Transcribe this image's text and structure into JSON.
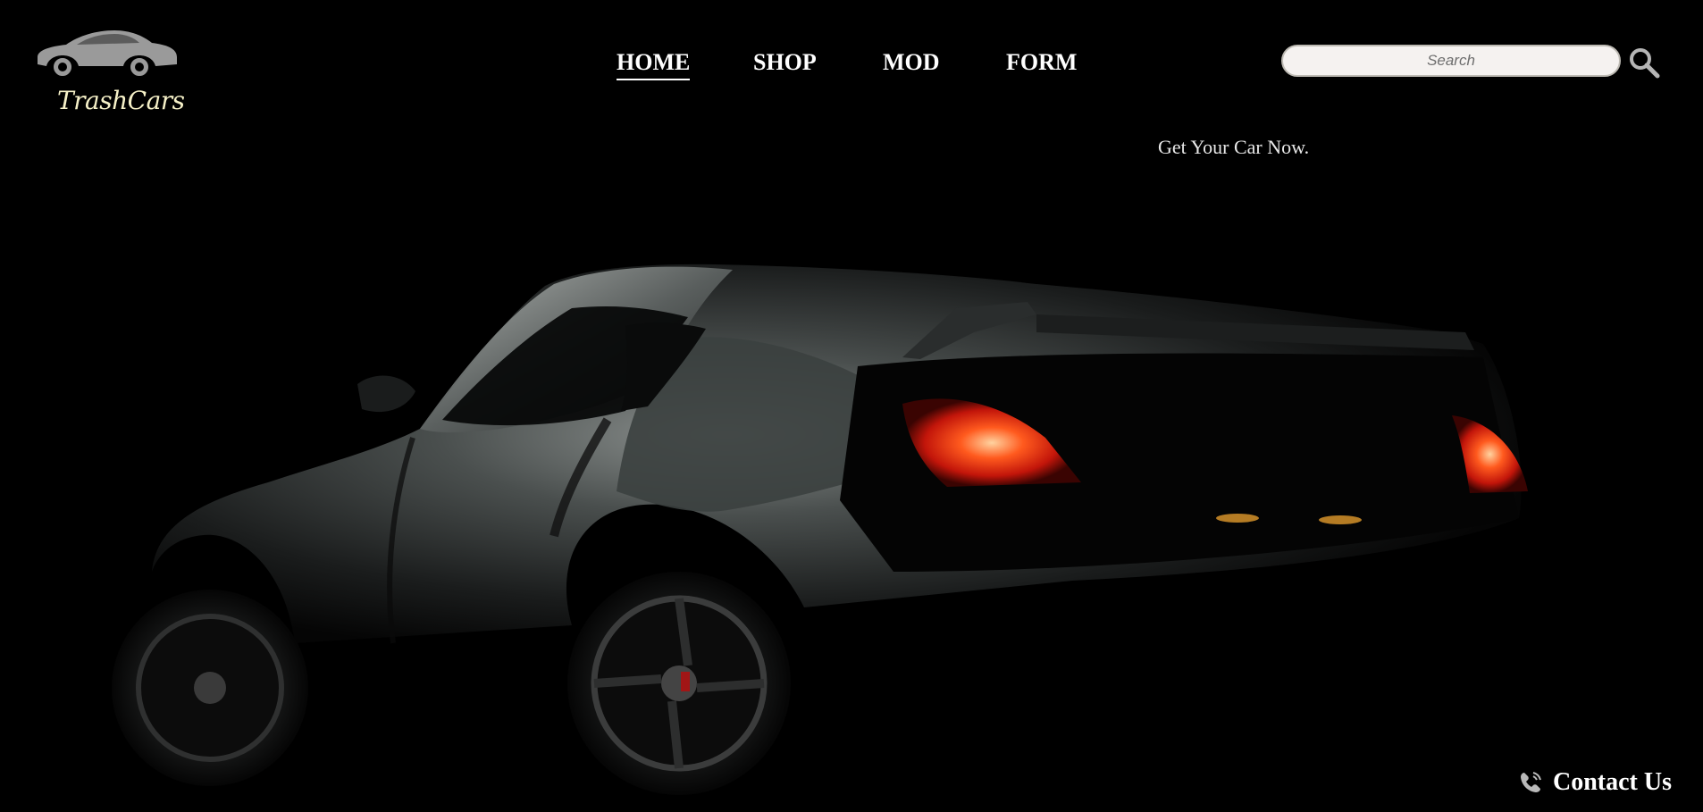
{
  "brand": {
    "name": "TrashCars",
    "logo_icon": "car-silhouette-icon",
    "logo_color": "#9a9a9a",
    "name_color": "#f6f1c8"
  },
  "nav": {
    "items": [
      {
        "label": "HOME",
        "active": true
      },
      {
        "label": "SHOP",
        "active": false
      },
      {
        "label": "MOD",
        "active": false
      },
      {
        "label": "FORM",
        "active": false
      }
    ]
  },
  "search": {
    "placeholder": "Search",
    "value": "",
    "icon": "search-icon"
  },
  "hero": {
    "tagline": "Get Your Car Now.",
    "image": "dark-sports-car-photo",
    "taillight_color": "#ff3a14"
  },
  "contact": {
    "label": "Contact Us",
    "icon": "phone-icon"
  },
  "colors": {
    "background": "#000000",
    "text": "#ffffff"
  }
}
